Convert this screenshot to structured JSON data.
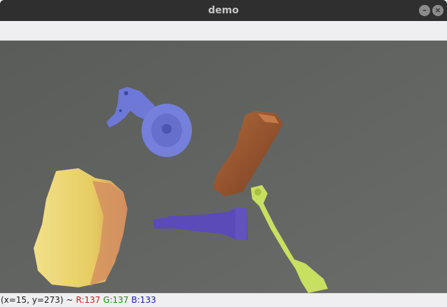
{
  "window": {
    "title": "demo"
  },
  "controls": {
    "minimize_glyph": "–",
    "close_glyph": "×"
  },
  "canvas": {
    "background": "#5e605e",
    "objects": [
      {
        "name": "caster-wheel",
        "color": "#6e78d6"
      },
      {
        "name": "wooden-block",
        "color": "#8a4a2a"
      },
      {
        "name": "wrench",
        "color": "#c8e060"
      },
      {
        "name": "nozzle",
        "color": "#5a4bb8"
      },
      {
        "name": "sponge-object",
        "color": "#e8d070"
      }
    ]
  },
  "status": {
    "coords": "(x=15, y=273) ~",
    "r": "R:137",
    "g": "G:137",
    "b": "B:133",
    "r_color": "#d01818",
    "g_color": "#1a8a1a",
    "b_color": "#1818c0"
  }
}
